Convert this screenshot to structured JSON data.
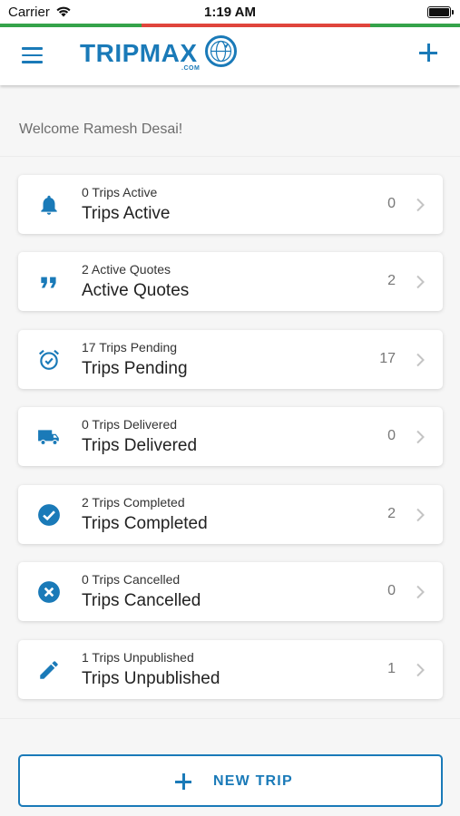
{
  "status_bar": {
    "carrier": "Carrier",
    "time": "1:19 AM"
  },
  "header": {
    "logo_text": "TRIPMAX",
    "logo_suffix": ".COM",
    "brand_color": "#1a7ab8"
  },
  "welcome": "Welcome Ramesh Desai!",
  "cards": [
    {
      "icon": "bell-icon",
      "small": "0 Trips Active",
      "big": "Trips Active",
      "count": "0"
    },
    {
      "icon": "quote-icon",
      "small": "2 Active Quotes",
      "big": "Active Quotes",
      "count": "2"
    },
    {
      "icon": "alarm-clock-icon",
      "small": "17 Trips Pending",
      "big": "Trips Pending",
      "count": "17"
    },
    {
      "icon": "truck-icon",
      "small": "0 Trips Delivered",
      "big": "Trips Delivered",
      "count": "0"
    },
    {
      "icon": "check-circle-icon",
      "small": "2 Trips Completed",
      "big": "Trips Completed",
      "count": "2"
    },
    {
      "icon": "cancel-circle-icon",
      "small": "0 Trips Cancelled",
      "big": "Trips Cancelled",
      "count": "0"
    },
    {
      "icon": "pencil-icon",
      "small": "1 Trips Unpublished",
      "big": "Trips Unpublished",
      "count": "1"
    }
  ],
  "new_trip_label": "NEW TRIP"
}
